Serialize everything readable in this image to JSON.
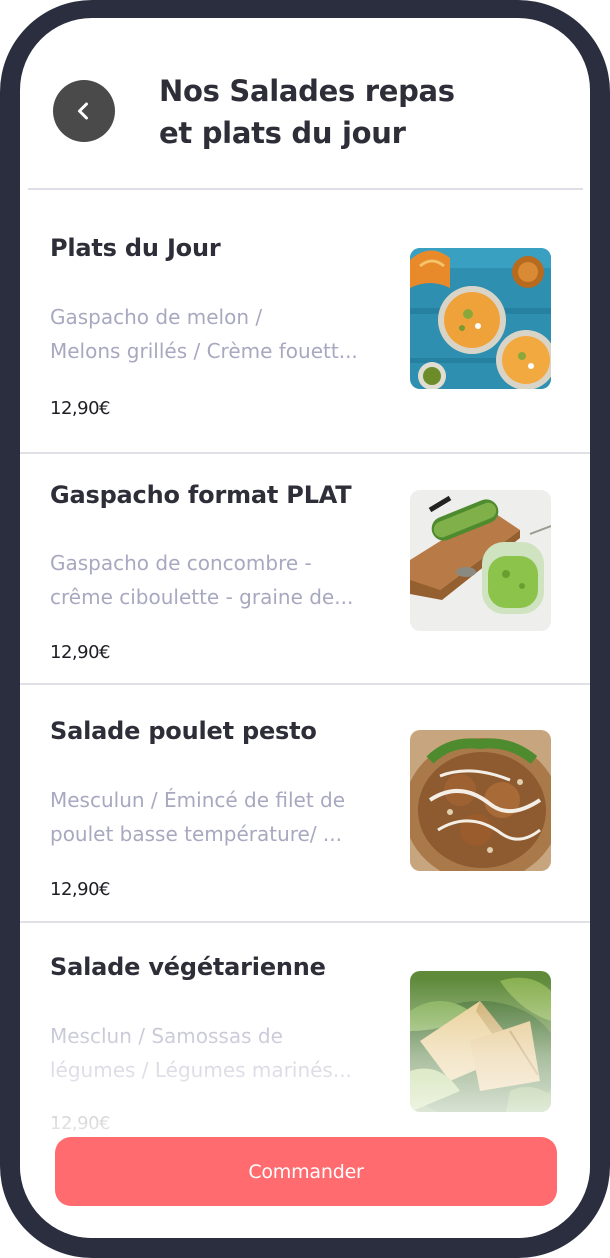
{
  "header": {
    "back_icon": "chevron-left-icon",
    "title_line_1": "Nos Salades repas",
    "title_line_2": "et plats du jour"
  },
  "items": [
    {
      "name": "Plats du Jour",
      "desc_line_1": "Gaspacho de melon /",
      "desc_line_2": "Melons grillés / Crème fouett...",
      "price": "12,90€",
      "image": "melon-gaspacho-photo"
    },
    {
      "name": "Gaspacho format PLAT",
      "desc_line_1": "Gaspacho de concombre -",
      "desc_line_2": "crême ciboulette - graine de...",
      "price": "12,90€",
      "image": "cucumber-gaspacho-photo"
    },
    {
      "name": "Salade poulet pesto",
      "desc_line_1": "Mesculun / Émincé de filet de",
      "desc_line_2": "poulet basse température/ ...",
      "price": "12,90€",
      "image": "chicken-pesto-salad-photo"
    },
    {
      "name": "Salade végétarienne",
      "desc_line_1": "Mesclun / Samossas de",
      "desc_line_2": "légumes  / Légumes marinés...",
      "price": "12,90€",
      "image": "vegetarian-salad-photo"
    }
  ],
  "footer": {
    "order_label": "Commander"
  },
  "colors": {
    "frame": "#2a2e3e",
    "accent": "#ff6b6e",
    "title": "#2e2e38",
    "description": "#a8a8c0"
  }
}
